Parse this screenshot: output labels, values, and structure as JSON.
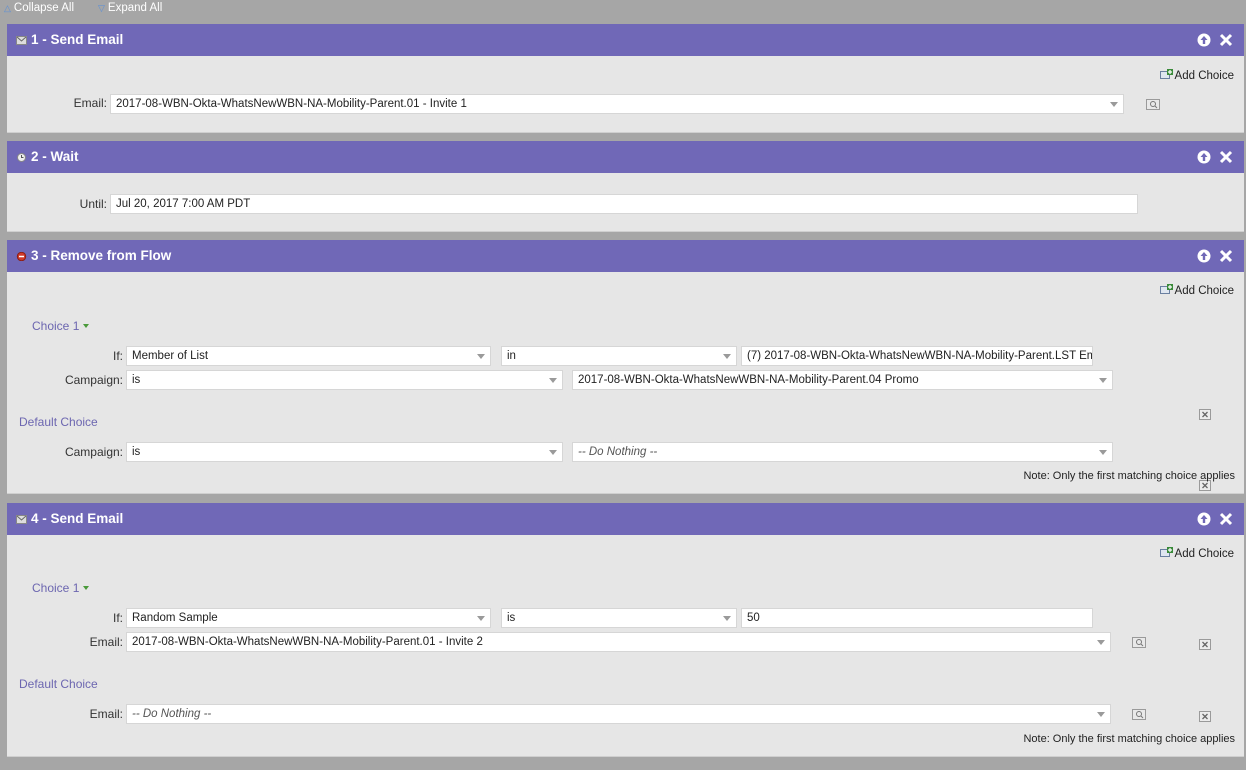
{
  "toolbar": {
    "collapse_all": "Collapse All",
    "expand_all": "Expand All"
  },
  "steps": [
    {
      "title": "1 - Send Email",
      "icon": "email-icon",
      "add_choice": "Add Choice",
      "email_label": "Email:",
      "email_value": "2017-08-WBN-Okta-WhatsNewWBN-NA-Mobility-Parent.01 - Invite 1"
    },
    {
      "title": "2 - Wait",
      "icon": "clock-icon",
      "until_label": "Until:",
      "until_value": "Jul 20, 2017 7:00 AM PDT"
    },
    {
      "title": "3 - Remove from Flow",
      "icon": "remove-flow-icon",
      "add_choice": "Add Choice",
      "choice_label": "Choice 1",
      "if_label": "If:",
      "if_value": "Member of List",
      "op_value": "in",
      "list_value": "(7) 2017-08-WBN-Okta-WhatsNewWBN-NA-Mobility-Parent.LST Em",
      "campaign_label": "Campaign:",
      "campaign_op": "is",
      "campaign_value": "2017-08-WBN-Okta-WhatsNewWBN-NA-Mobility-Parent.04 Promo",
      "default_label": "Default Choice",
      "default_campaign_label": "Campaign:",
      "default_campaign_op": "is",
      "default_campaign_value": "-- Do Nothing --",
      "note": "Note: Only the first matching choice applies"
    },
    {
      "title": "4 - Send Email",
      "icon": "email-icon",
      "add_choice": "Add Choice",
      "choice_label": "Choice 1",
      "if_label": "If:",
      "if_value": "Random Sample",
      "op_value": "is",
      "amount_value": "50",
      "email_label": "Email:",
      "email_value": "2017-08-WBN-Okta-WhatsNewWBN-NA-Mobility-Parent.01 - Invite 2",
      "default_label": "Default Choice",
      "default_email_label": "Email:",
      "default_email_value": "-- Do Nothing --",
      "note": "Note: Only the first matching choice applies"
    }
  ],
  "colors": {
    "header": "#7068b7",
    "body": "#e6e6e6",
    "page": "#a6a6a6",
    "choice": "#6c66b0"
  }
}
